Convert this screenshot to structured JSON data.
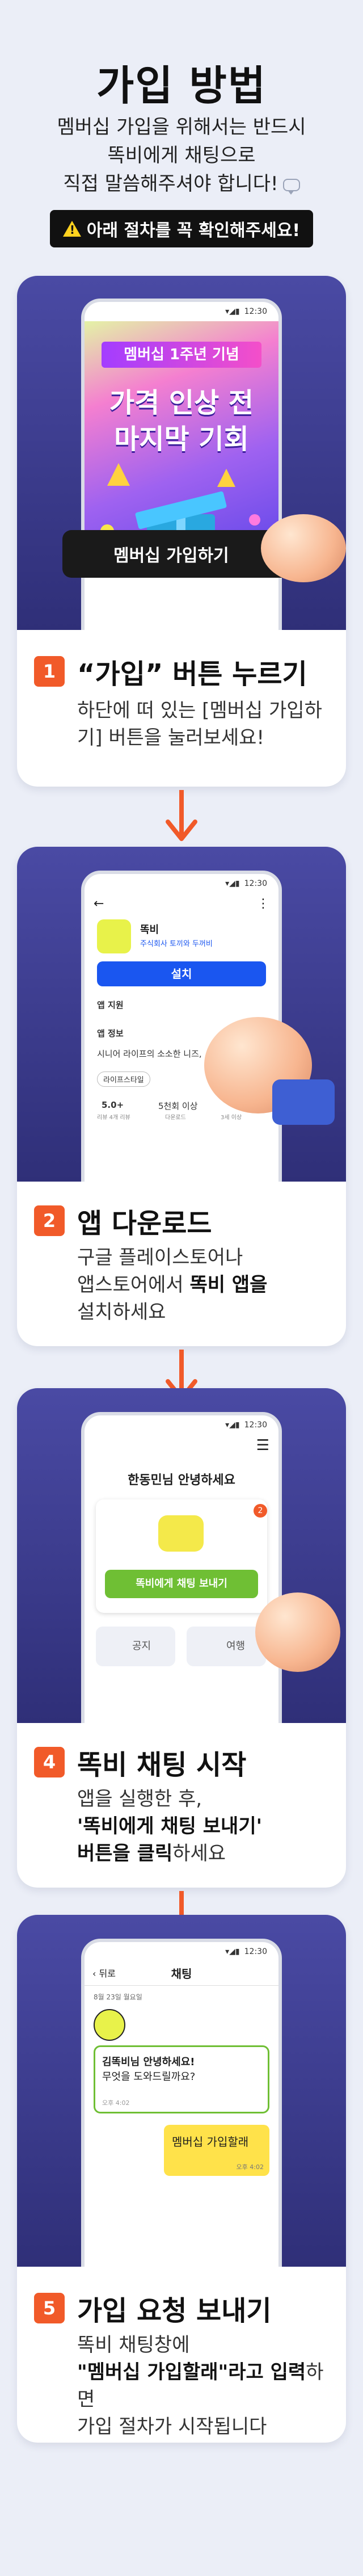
{
  "header": {
    "title": "가입 방법",
    "desc_lines": [
      "멤버십 가입을 위해서는 반드시",
      "똑비에게 채팅으로",
      "직접 말씀해주셔야 합니다!"
    ],
    "alert": "아래 절차를 꼭 확인해주세요!"
  },
  "step1": {
    "num": "1",
    "title": "“가입” 버튼 누르기",
    "desc_lines": [
      "하단에 떠 있는 [멤버십 가입하",
      "기] 버튼을 눌러보세요!"
    ],
    "banner_tag": "멤버십 1주년 기념",
    "banner_line1": "가격 인상 전",
    "banner_line2": "마지막 기회",
    "join_button": "멤버십 가입하기",
    "status_time": "12:30"
  },
  "step2": {
    "num": "2",
    "title": "앱 다운로드",
    "desc_lines": [
      "구글 플레이스토어나",
      "앱스토어에서 ",
      "똑비 앱을",
      "설치하세요"
    ],
    "app_name": "똑비",
    "app_sub": "주식회사 토끼와 두꺼비",
    "install": "설치",
    "app_support": "앱 지원",
    "app_info": "앱 정보",
    "app_desc": "시니어 라이프의 소소한 니즈,",
    "chip": "라이프스타일",
    "rating": "5.0+",
    "rating_sub": "리뷰 4개 리뷰",
    "downloads": "5천회 이상",
    "downloads_sub": "다운로드",
    "age": "3세 이상",
    "status_time": "12:30"
  },
  "step3": {
    "num": "4",
    "title": "똑비 채팅 시작",
    "desc_lines": [
      "앱을 실행한 후,",
      "'똑비에게 채팅 보내기'",
      "버튼을 클릭",
      "하세요"
    ],
    "greeting": "한동민님 안녕하세요",
    "badge": "2",
    "chat_button": "똑비에게 채팅 보내기",
    "notice": "공지",
    "travel": "여행",
    "status_time": "12:30"
  },
  "step4": {
    "num": "5",
    "title": "가입 요청 보내기",
    "desc_lines": [
      "똑비 채팅창에",
      "\"멤버십 가입할래\"라고 입력",
      "하면",
      "가입 절차가 시작됩니다"
    ],
    "back": "뒤로",
    "chat_title": "채팅",
    "date": "8월 23일 월요일",
    "bot_msg_line1": "김똑비님 안녕하세요!",
    "bot_msg_line2": "무엇을 도와드릴까요?",
    "bot_time": "오후 4:02",
    "user_msg": "멤버십 가입할래",
    "user_time": "오후 4:02",
    "status_time": "12:30"
  },
  "colors": {
    "accent_orange": "#f15a29",
    "dark_card": "#3b3b90",
    "green": "#6fbf34",
    "blue": "#1a56f0",
    "yellow": "#ffe24a"
  }
}
